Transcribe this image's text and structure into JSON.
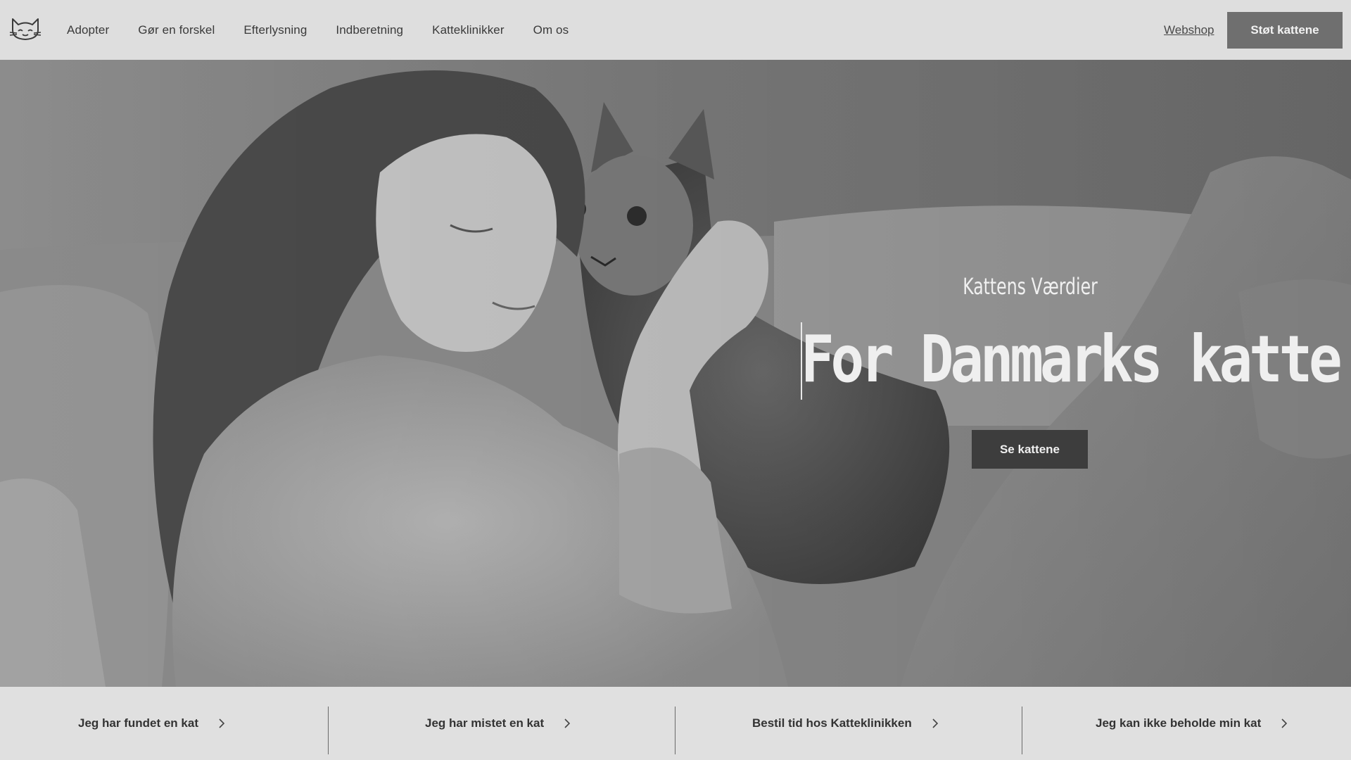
{
  "header": {
    "logo_icon": "cat-face-icon",
    "nav": [
      {
        "label": "Adopter"
      },
      {
        "label": "Gør en forskel"
      },
      {
        "label": "Efterlysning"
      },
      {
        "label": "Indberetning"
      },
      {
        "label": "Katteklinikker"
      },
      {
        "label": "Om os"
      }
    ],
    "webshop_label": "Webshop",
    "cta_label": "Støt kattene"
  },
  "hero": {
    "subtitle": "Kattens Værdier",
    "title": "For Danmarks katte",
    "button_label": "Se kattene"
  },
  "quicklinks": [
    {
      "label": "Jeg har fundet en kat",
      "icon": "chevron-right-icon"
    },
    {
      "label": "Jeg har mistet en kat",
      "icon": "chevron-right-icon"
    },
    {
      "label": "Bestil tid hos Katteklinikken",
      "icon": "chevron-right-icon"
    },
    {
      "label": "Jeg kan ikke beholde min kat",
      "icon": "chevron-right-icon"
    }
  ],
  "colors": {
    "header_bg": "#dedede",
    "cta_bg": "#6f6f6f",
    "hero_button_bg": "#3d3d3d",
    "quicklinks_bg": "#e0e0e0"
  }
}
